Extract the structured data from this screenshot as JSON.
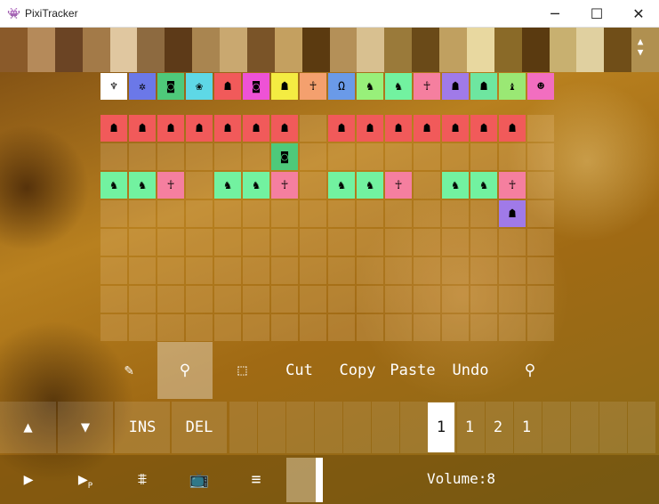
{
  "window": {
    "title": "PixiTracker",
    "minimize": "─",
    "maximize": "☐",
    "close": "✕"
  },
  "top_strip": [
    "#8a5a2a",
    "#b58a5a",
    "#6b4424",
    "#a37a48",
    "#e0c7a0",
    "#8d6a40",
    "#5d3a18",
    "#a98550",
    "#c9a870",
    "#7a5428",
    "#c4a060",
    "#5b3a10",
    "#b49058",
    "#d8c090",
    "#9a7a3a",
    "#6a4a18",
    "#c0a060",
    "#e8d8a0",
    "#8a6a28",
    "#5a3a10",
    "#c8b070",
    "#e0d0a0",
    "#704e18",
    "#b09050"
  ],
  "instruments": [
    {
      "color": "#ffffff",
      "glyph": "♆"
    },
    {
      "color": "#6b78e8",
      "glyph": "✲"
    },
    {
      "color": "#4ec97a",
      "glyph": "◙"
    },
    {
      "color": "#5ed8e6",
      "glyph": "❀"
    },
    {
      "color": "#f15a5a",
      "glyph": "☗"
    },
    {
      "color": "#ee52d6",
      "glyph": "◙"
    },
    {
      "color": "#f4ec42",
      "glyph": "☗"
    },
    {
      "color": "#f4a06e",
      "glyph": "☥"
    },
    {
      "color": "#6a9ae8",
      "glyph": "Ω"
    },
    {
      "color": "#98f07a",
      "glyph": "♞"
    },
    {
      "color": "#72f2a0",
      "glyph": "♞"
    },
    {
      "color": "#f57f9f",
      "glyph": "☥"
    },
    {
      "color": "#a07ae8",
      "glyph": "☗"
    },
    {
      "color": "#6ee6a0",
      "glyph": "☗"
    },
    {
      "color": "#9ae874",
      "glyph": "♝"
    },
    {
      "color": "#f26ec0",
      "glyph": "☻"
    }
  ],
  "grid": {
    "rows": 8,
    "cols": 16
  },
  "notes": [
    {
      "r": 0,
      "c": 0,
      "color": "#f15a5a",
      "glyph": "☗"
    },
    {
      "r": 0,
      "c": 1,
      "color": "#f15a5a",
      "glyph": "☗"
    },
    {
      "r": 0,
      "c": 2,
      "color": "#f15a5a",
      "glyph": "☗"
    },
    {
      "r": 0,
      "c": 3,
      "color": "#f15a5a",
      "glyph": "☗"
    },
    {
      "r": 0,
      "c": 4,
      "color": "#f15a5a",
      "glyph": "☗"
    },
    {
      "r": 0,
      "c": 5,
      "color": "#f15a5a",
      "glyph": "☗"
    },
    {
      "r": 0,
      "c": 6,
      "color": "#f15a5a",
      "glyph": "☗"
    },
    {
      "r": 0,
      "c": 8,
      "color": "#f15a5a",
      "glyph": "☗"
    },
    {
      "r": 0,
      "c": 9,
      "color": "#f15a5a",
      "glyph": "☗"
    },
    {
      "r": 0,
      "c": 10,
      "color": "#f15a5a",
      "glyph": "☗"
    },
    {
      "r": 0,
      "c": 11,
      "color": "#f15a5a",
      "glyph": "☗"
    },
    {
      "r": 0,
      "c": 12,
      "color": "#f15a5a",
      "glyph": "☗"
    },
    {
      "r": 0,
      "c": 13,
      "color": "#f15a5a",
      "glyph": "☗"
    },
    {
      "r": 0,
      "c": 14,
      "color": "#f15a5a",
      "glyph": "☗"
    },
    {
      "r": 1,
      "c": 6,
      "color": "#4ec97a",
      "glyph": "◙"
    },
    {
      "r": 2,
      "c": 0,
      "color": "#72f2a0",
      "glyph": "♞"
    },
    {
      "r": 2,
      "c": 1,
      "color": "#72f2a0",
      "glyph": "♞"
    },
    {
      "r": 2,
      "c": 2,
      "color": "#f57f9f",
      "glyph": "☥"
    },
    {
      "r": 2,
      "c": 4,
      "color": "#72f2a0",
      "glyph": "♞"
    },
    {
      "r": 2,
      "c": 5,
      "color": "#72f2a0",
      "glyph": "♞"
    },
    {
      "r": 2,
      "c": 6,
      "color": "#f57f9f",
      "glyph": "☥"
    },
    {
      "r": 2,
      "c": 8,
      "color": "#72f2a0",
      "glyph": "♞"
    },
    {
      "r": 2,
      "c": 9,
      "color": "#72f2a0",
      "glyph": "♞"
    },
    {
      "r": 2,
      "c": 10,
      "color": "#f57f9f",
      "glyph": "☥"
    },
    {
      "r": 2,
      "c": 12,
      "color": "#72f2a0",
      "glyph": "♞"
    },
    {
      "r": 2,
      "c": 13,
      "color": "#72f2a0",
      "glyph": "♞"
    },
    {
      "r": 2,
      "c": 14,
      "color": "#f57f9f",
      "glyph": "☥"
    },
    {
      "r": 3,
      "c": 14,
      "color": "#a07ae8",
      "glyph": "☗"
    }
  ],
  "tools": {
    "pencil": "✎",
    "picker": "⚲",
    "select": "⬚",
    "cut": "Cut",
    "copy": "Copy",
    "paste": "Paste",
    "undo": "Undo",
    "zoom": "⚲"
  },
  "edit": {
    "up": "▲",
    "down": "▼",
    "ins": "INS",
    "del": "DEL"
  },
  "patterns": [
    {
      "label": "1",
      "selected": true
    },
    {
      "label": "1",
      "selected": false
    },
    {
      "label": "2",
      "selected": false
    },
    {
      "label": "1",
      "selected": false
    }
  ],
  "transport": {
    "play": "▶",
    "play_pattern": "▶",
    "play_pattern_sub": "P",
    "wave": "⩨",
    "tv": "📺",
    "menu": "≡"
  },
  "volume": {
    "label": "Volume:8"
  }
}
